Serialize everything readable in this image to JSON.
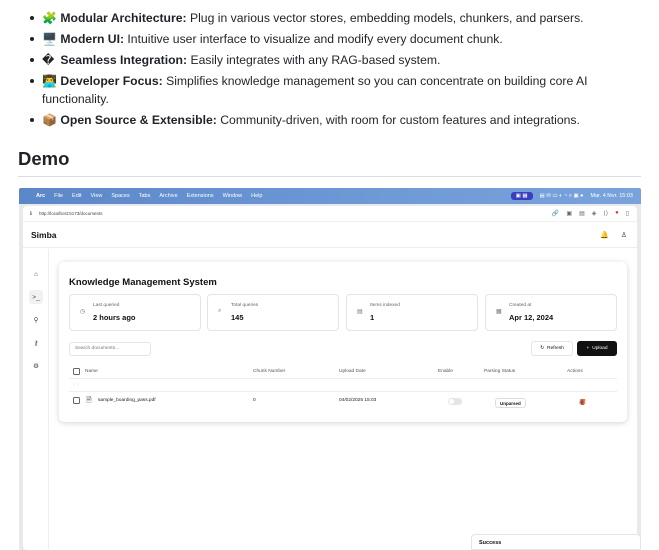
{
  "features": [
    {
      "emoji": "🧩",
      "title": "Modular Architecture:",
      "desc": "Plug in various vector stores, embedding models, chunkers, and parsers."
    },
    {
      "emoji": "🖥️",
      "title": "Modern UI:",
      "desc": "Intuitive user interface to visualize and modify every document chunk."
    },
    {
      "emoji": "�",
      "title": "Seamless Integration:",
      "desc": "Easily integrates with any RAG-based system."
    },
    {
      "emoji": "👨‍💻",
      "title": "Developer Focus:",
      "desc": "Simplifies knowledge management so you can concentrate on building core AI functionality."
    },
    {
      "emoji": "📦",
      "title": "Open Source & Extensible:",
      "desc": "Community-driven, with room for custom features and integrations."
    }
  ],
  "demo_heading": "Demo",
  "screenshot": {
    "menubar": {
      "apple": "",
      "items": [
        "Arc",
        "File",
        "Edit",
        "View",
        "Spaces",
        "Tabs",
        "Archive",
        "Extensions",
        "Window",
        "Help"
      ],
      "clock": "Mar. 4 févr. 15:03"
    },
    "url": "http://localhost:5173/documents",
    "app_name": "Simba",
    "card_title": "Knowledge Management System",
    "stats": [
      {
        "label": "Last queried",
        "value": "2 hours ago",
        "icon": "clock-icon"
      },
      {
        "label": "Total queries",
        "value": "145",
        "icon": "search-icon"
      },
      {
        "label": "Items indexed",
        "value": "1",
        "icon": "database-icon"
      },
      {
        "label": "Created at",
        "value": "Apr 12, 2024",
        "icon": "calendar-icon"
      }
    ],
    "search_placeholder": "Search documents...",
    "refresh_label": "Refresh",
    "upload_label": "Upload",
    "columns": [
      "Name",
      "Chunk Number",
      "Upload Date",
      "Enable",
      "Parsing Status",
      "Actions"
    ],
    "rows": [
      {
        "name": "sample_boarding_pass.pdf",
        "chunks": "0",
        "date": "04/02/2025 15:03",
        "enabled": false,
        "status": "Unparsed"
      }
    ],
    "toast": "Success"
  }
}
